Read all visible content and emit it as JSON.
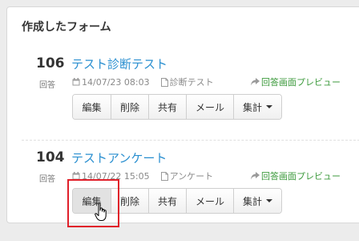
{
  "panel": {
    "title": "作成したフォーム"
  },
  "forms": [
    {
      "count": "106",
      "count_label": "回答",
      "title": "テスト診断テスト",
      "date": "14/07/23 08:03",
      "type": "診断テスト",
      "preview": "回答画面プレビュー",
      "buttons": {
        "edit": "編集",
        "delete": "削除",
        "share": "共有",
        "mail": "メール",
        "aggregate": "集計"
      }
    },
    {
      "count": "104",
      "count_label": "回答",
      "title": "テストアンケート",
      "date": "14/07/22 15:05",
      "type": "アンケート",
      "preview": "回答画面プレビュー",
      "buttons": {
        "edit": "編集",
        "delete": "削除",
        "share": "共有",
        "mail": "メール",
        "aggregate": "集計"
      }
    }
  ],
  "colors": {
    "link": "#2a8fd0",
    "preview": "#3c9a3c",
    "highlight": "#e0202a"
  },
  "icons": [
    "calendar-icon",
    "document-icon",
    "share-arrow-icon",
    "caret-down-icon",
    "hand-cursor-icon"
  ]
}
